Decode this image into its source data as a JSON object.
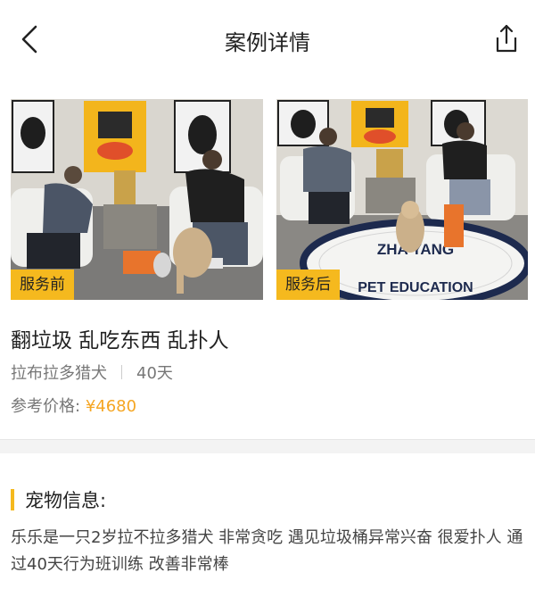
{
  "header": {
    "title": "案例详情",
    "back_icon": "chevron-left-icon",
    "share_icon": "share-icon"
  },
  "gallery": {
    "before_label": "服务前",
    "after_label": "服务后",
    "rug_text_top": "ZHA  YANG",
    "rug_text_bottom": "PET EDUCATION"
  },
  "case": {
    "title": "翻垃圾 乱吃东西 乱扑人",
    "breed": "拉布拉多猎犬",
    "duration": "40天",
    "price_label": "参考价格:",
    "price_value": "¥4680"
  },
  "pet_info": {
    "section_title": "宠物信息:",
    "description": "乐乐是一只2岁拉不拉多猎犬 非常贪吃 遇见垃圾桶异常兴奋 很爱扑人 通过40天行为班训练 改善非常棒"
  },
  "colors": {
    "accent": "#f5b91e",
    "price": "#f5a623",
    "divider": "#f3f3f3"
  }
}
